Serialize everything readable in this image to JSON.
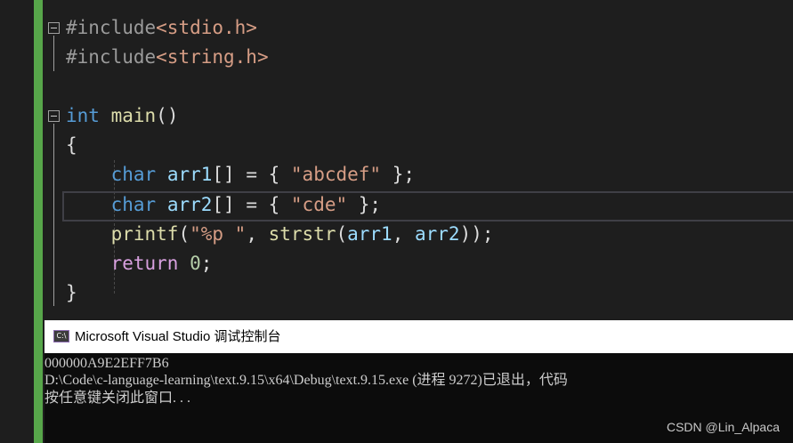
{
  "editor": {
    "lines": [
      {
        "parts": [
          {
            "t": "#include",
            "c": "pp"
          },
          {
            "t": "<stdio.h>",
            "c": "inc"
          }
        ]
      },
      {
        "parts": [
          {
            "t": "#include",
            "c": "pp"
          },
          {
            "t": "<string.h>",
            "c": "inc"
          }
        ]
      },
      {
        "parts": []
      },
      {
        "parts": [
          {
            "t": "int",
            "c": "kw"
          },
          {
            "t": " ",
            "c": ""
          },
          {
            "t": "main",
            "c": "fn"
          },
          {
            "t": "()",
            "c": ""
          }
        ]
      },
      {
        "parts": [
          {
            "t": "{",
            "c": ""
          }
        ]
      },
      {
        "parts": [
          {
            "t": "    ",
            "c": ""
          },
          {
            "t": "char",
            "c": "kw"
          },
          {
            "t": " ",
            "c": ""
          },
          {
            "t": "arr1",
            "c": "var"
          },
          {
            "t": "[] = { ",
            "c": ""
          },
          {
            "t": "\"abcdef\"",
            "c": "str"
          },
          {
            "t": " };",
            "c": ""
          }
        ]
      },
      {
        "parts": [
          {
            "t": "    ",
            "c": ""
          },
          {
            "t": "char",
            "c": "kw"
          },
          {
            "t": " ",
            "c": ""
          },
          {
            "t": "arr2",
            "c": "var"
          },
          {
            "t": "[] = { ",
            "c": ""
          },
          {
            "t": "\"cde\"",
            "c": "str"
          },
          {
            "t": " };",
            "c": ""
          }
        ]
      },
      {
        "parts": [
          {
            "t": "    ",
            "c": ""
          },
          {
            "t": "printf",
            "c": "fn"
          },
          {
            "t": "(",
            "c": ""
          },
          {
            "t": "\"%p \"",
            "c": "str"
          },
          {
            "t": ", ",
            "c": ""
          },
          {
            "t": "strstr",
            "c": "fn"
          },
          {
            "t": "(",
            "c": ""
          },
          {
            "t": "arr1",
            "c": "var"
          },
          {
            "t": ", ",
            "c": ""
          },
          {
            "t": "arr2",
            "c": "var"
          },
          {
            "t": "));",
            "c": ""
          }
        ]
      },
      {
        "parts": [
          {
            "t": "    ",
            "c": ""
          },
          {
            "t": "return",
            "c": "ctl"
          },
          {
            "t": " ",
            "c": ""
          },
          {
            "t": "0",
            "c": "num"
          },
          {
            "t": ";",
            "c": ""
          }
        ]
      },
      {
        "parts": [
          {
            "t": "}",
            "c": ""
          }
        ]
      }
    ]
  },
  "console": {
    "title": "Microsoft Visual Studio 调试控制台",
    "icon": "console-app-icon",
    "lines": [
      "000000A9E2EFF7B6",
      "D:\\Code\\c-language-learning\\text.9.15\\x64\\Debug\\text.9.15.exe (进程 9272)已退出，代码",
      "按任意键关闭此窗口. . ."
    ]
  },
  "watermark": "CSDN @Lin_Alpaca",
  "colors": {
    "background": "#1e1e1e",
    "change_bar": "#57a64a",
    "keyword": "#569cd6",
    "string": "#d69d85",
    "function": "#dcdcaa",
    "variable": "#9cdcfe",
    "number": "#b5cea8",
    "control": "#d8a0df"
  }
}
